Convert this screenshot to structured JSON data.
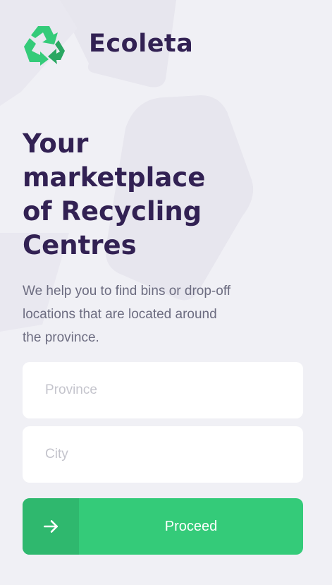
{
  "app": {
    "name": "Ecoleta",
    "logo_icon": "recycle-icon"
  },
  "hero": {
    "title_lines": [
      "Your",
      "marketplace",
      "of Recycling",
      "Centres"
    ],
    "description_lines": [
      "We help you to find bins or drop-off",
      "locations that are located around",
      "the province."
    ]
  },
  "form": {
    "province": {
      "placeholder": "Province",
      "value": ""
    },
    "city": {
      "placeholder": "City",
      "value": ""
    },
    "proceed": {
      "label": "Proceed",
      "icon": "arrow-right-icon"
    }
  },
  "colors": {
    "background": "#F0F0F5",
    "title": "#322153",
    "text": "#6C6C80",
    "primary": "#34CB79",
    "primary_dark": "#2FB86E",
    "input_bg": "#FFFFFF",
    "placeholder": "#C4C4CC"
  }
}
